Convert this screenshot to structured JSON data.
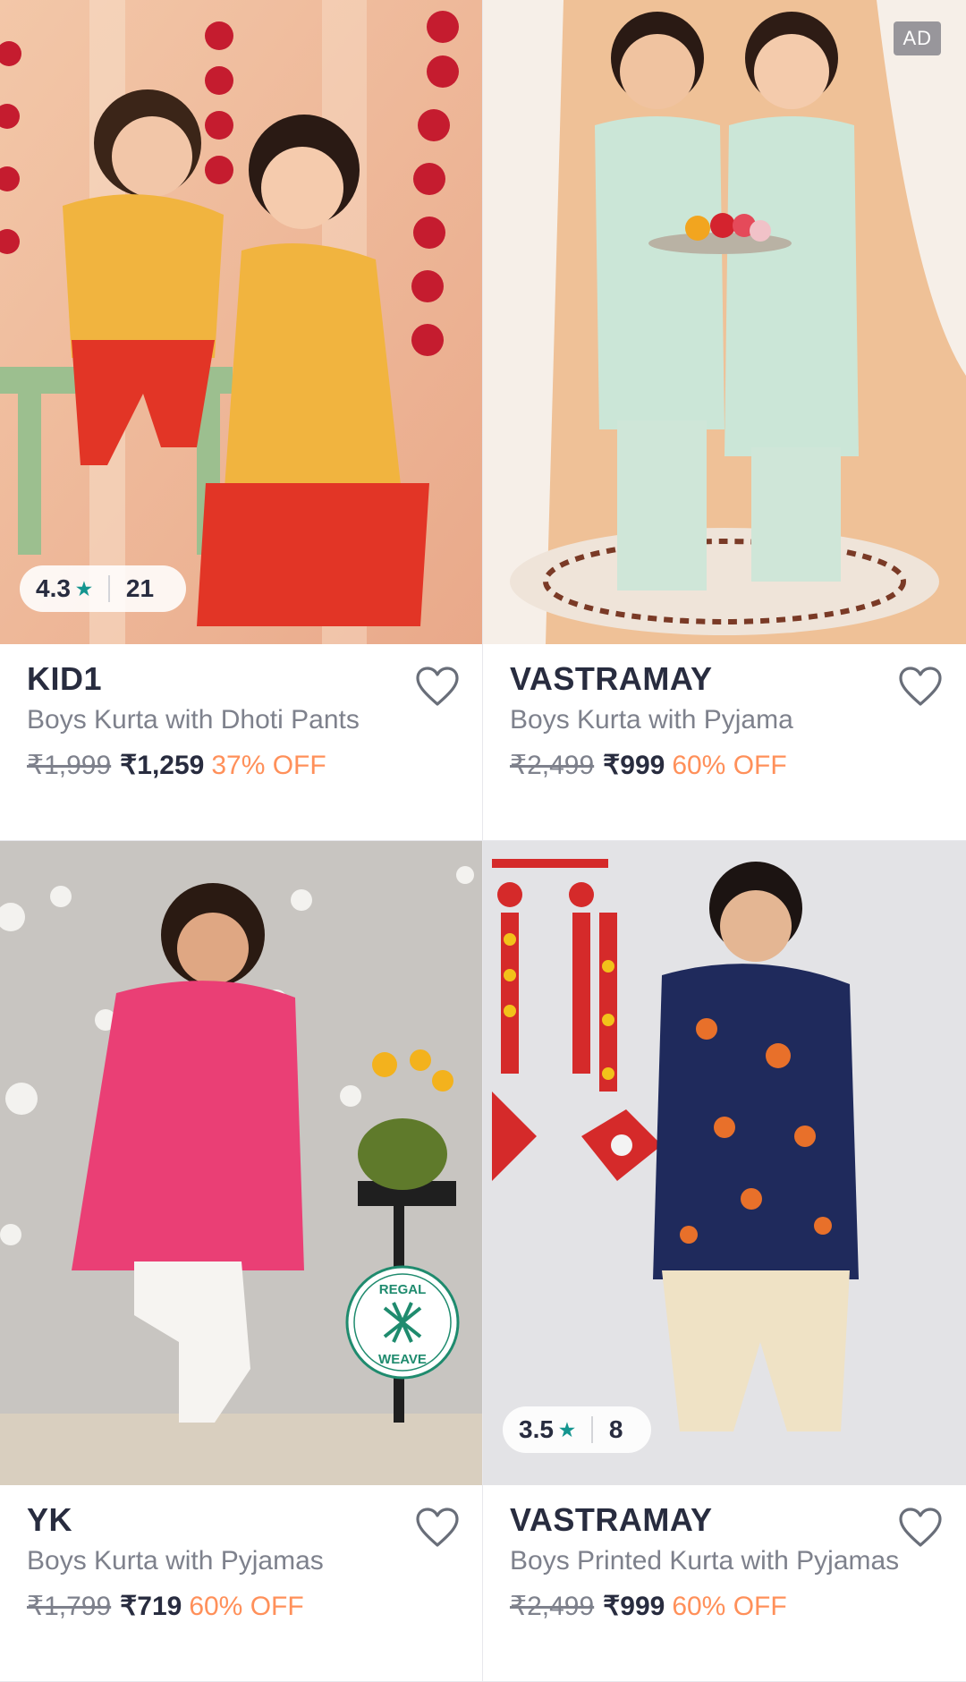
{
  "products": [
    {
      "brand": "KID1",
      "name": "Boys Kurta with Dhoti Pants",
      "mrp": "₹1,999",
      "price": "₹1,259",
      "discount": "37% OFF",
      "rating": "4.3",
      "rating_count": "21",
      "image_desc": "two kids in printed kurta outfits"
    },
    {
      "brand": "VASTRAMAY",
      "name": "Boys Kurta with Pyjama",
      "mrp": "₹2,499",
      "price": "₹999",
      "discount": "60% OFF",
      "ad_label": "AD",
      "image_desc": "two kids in mint green kurtas holding flower plate"
    },
    {
      "brand": "YK",
      "name": "Boys Kurta with Pyjamas",
      "mrp": "₹1,799",
      "price": "₹719",
      "discount": "60% OFF",
      "badge_top": "REGAL",
      "badge_bottom": "WEAVE",
      "image_desc": "boy in pink kurta and white pyjama"
    },
    {
      "brand": "VASTRAMAY",
      "name": "Boys Printed Kurta with Pyjamas",
      "mrp": "₹2,499",
      "price": "₹999",
      "discount": "60% OFF",
      "rating": "3.5",
      "rating_count": "8",
      "image_desc": "boy in navy floral printed kurta"
    }
  ],
  "colors": {
    "brand_text": "#282c3f",
    "muted_text": "#7e818c",
    "discount": "#ff905a",
    "rating_star": "#14958f"
  },
  "icons": {
    "wishlist": "heart-outline-icon",
    "rating": "star-icon"
  }
}
